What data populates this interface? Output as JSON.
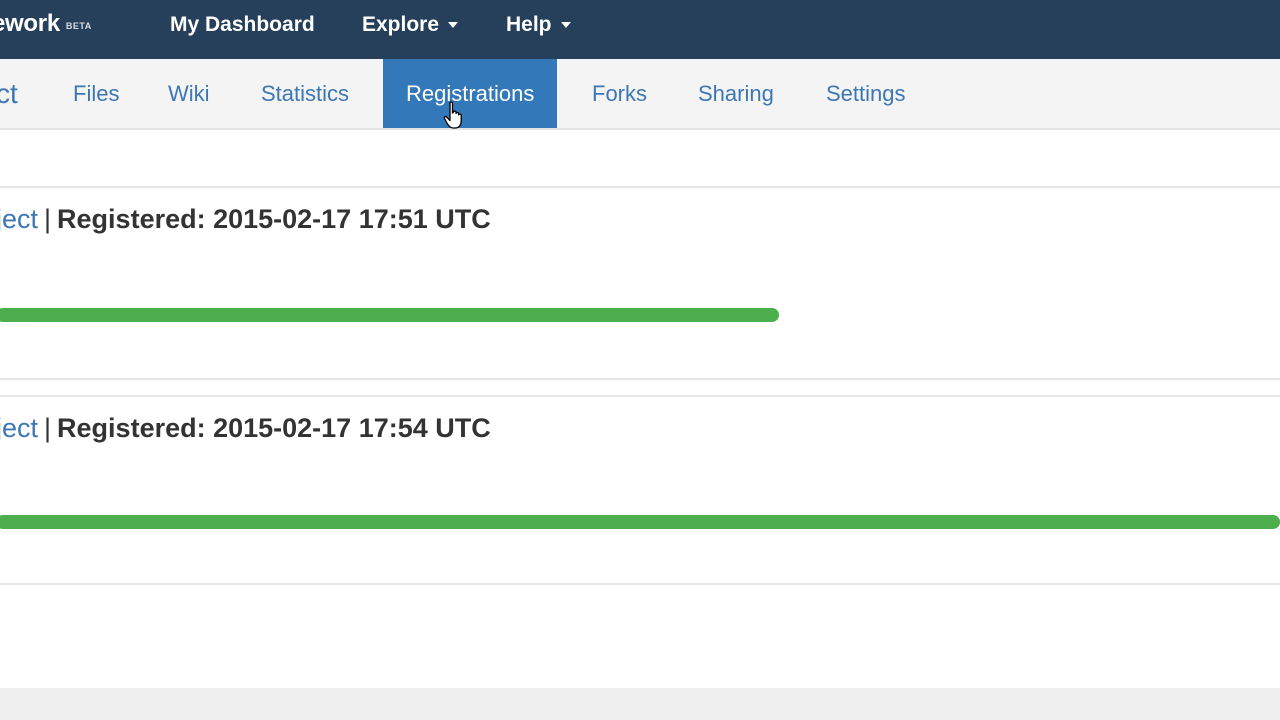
{
  "topnav": {
    "brand": "ework",
    "brand_badge": "BETA",
    "links": [
      {
        "label": "My Dashboard"
      },
      {
        "label": "Explore"
      },
      {
        "label": "Help"
      }
    ]
  },
  "subnav": {
    "title": "ct",
    "items": [
      {
        "label": "Files"
      },
      {
        "label": "Wiki"
      },
      {
        "label": "Statistics"
      },
      {
        "label": "Registrations"
      },
      {
        "label": "Forks"
      },
      {
        "label": "Sharing"
      },
      {
        "label": "Settings"
      }
    ],
    "active": "Registrations"
  },
  "registrations": [
    {
      "link": "ject",
      "separator": "|",
      "text": "Registered: 2015-02-17 17:51 UTC",
      "progress": 0.61
    },
    {
      "link": "ject",
      "separator": "|",
      "text": "Registered: 2015-02-17 17:54 UTC",
      "progress": 1.0
    }
  ],
  "colors": {
    "navbar": "#263f5a",
    "accent": "#3378b8",
    "link": "#3d77b3",
    "progress": "#4cae4c"
  }
}
